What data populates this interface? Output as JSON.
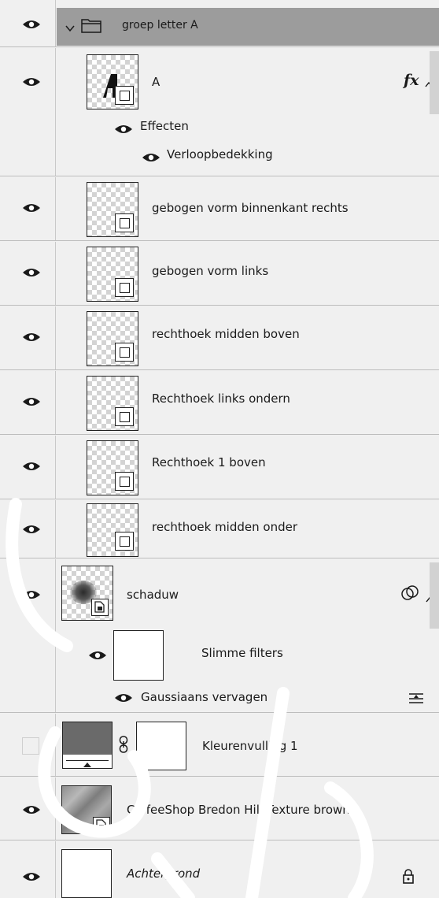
{
  "layers": {
    "group": {
      "label": "groep letter A"
    },
    "layer_a": {
      "label": "A",
      "fx_label": "fx"
    },
    "effects": {
      "label": "Effecten"
    },
    "gradient_overlay": {
      "label": "Verloopbedekking"
    },
    "shape_layers": [
      {
        "label": "gebogen vorm binnenkant rechts"
      },
      {
        "label": "gebogen vorm links"
      },
      {
        "label": "rechthoek midden boven"
      },
      {
        "label": "Rechthoek links ondern"
      },
      {
        "label": "Rechthoek 1 boven"
      },
      {
        "label": "rechthoek midden onder"
      }
    ],
    "shadow": {
      "label": "schaduw"
    },
    "smart_filters": {
      "label": "Slimme filters"
    },
    "gaussian_blur": {
      "label": "Gaussiaans vervagen"
    },
    "color_fill": {
      "label": "Kleurenvulling 1"
    },
    "texture": {
      "label": "CoffeeShop Bredon Hill Texture brown"
    },
    "background": {
      "label": "Achtergrond"
    }
  },
  "colors": {
    "panel_bg": "#f0f0f0",
    "group_header_bg": "#9c9c9c",
    "fill_swatch": "#6a6a6a",
    "watermark": "#ffffff"
  }
}
